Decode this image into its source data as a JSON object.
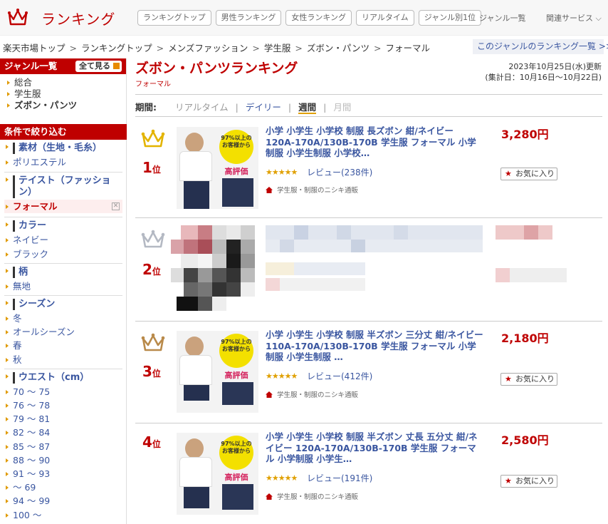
{
  "header": {
    "logo_text": "ランキング",
    "nav_pills": [
      "ランキングトップ",
      "男性ランキング",
      "女性ランキング",
      "リアルタイム",
      "ジャンル別1位"
    ],
    "genre_list_link": "ジャンル一覧",
    "related_services": "関連サービス ⌵"
  },
  "breadcrumb": [
    "楽天市場トップ",
    "ランキングトップ",
    "メンズファッション",
    "学生服",
    "ズボン・パンツ",
    "フォーマル"
  ],
  "genre_ranking_link": "このジャンルのランキング一覧 >>",
  "sidebar": {
    "genre_header": "ジャンル一覧",
    "all_button": "全て見る",
    "genres": [
      "総合",
      "学生服",
      "ズボン・パンツ"
    ],
    "filter_header": "条件で絞り込む",
    "groups": [
      {
        "title": "素材（生地・毛糸）",
        "items": [
          "ポリエステル"
        ]
      },
      {
        "title": "テイスト（ファッション）",
        "items": [
          "フォーマル"
        ]
      },
      {
        "title": "カラー",
        "items": [
          "ネイビー",
          "ブラック"
        ]
      },
      {
        "title": "柄",
        "items": [
          "無地"
        ]
      },
      {
        "title": "シーズン",
        "items": [
          "冬",
          "オールシーズン",
          "春",
          "秋"
        ]
      },
      {
        "title": "ウエスト（cm）",
        "items": [
          "70 ～ 75",
          "76 ～ 78",
          "79 ～ 81",
          "82 ～ 84",
          "85 ～ 87",
          "88 ～ 90",
          "91 ～ 93",
          "～ 69",
          "94 ～ 99",
          "100 ～"
        ]
      }
    ]
  },
  "main": {
    "title": "ズボン・パンツランキング",
    "subtitle": "フォーマル",
    "update_line1": "2023年10月25日(水)更新",
    "update_line2": "(集計日：10月16日～10月22日)",
    "period_label": "期間:",
    "periods": [
      "リアルタイム",
      "デイリー",
      "週間",
      "月間"
    ]
  },
  "items": [
    {
      "rank": "1",
      "rank_suffix": "位",
      "name": "小学 小学生 小学校 制服 長ズボン 紺/ネイビー 120A-170A/130B-170B 学生服 フォーマル 小学制服 小学生制服 小学校…",
      "price": "3,280円",
      "stars": "★★★★★",
      "reviews": "レビュー(238件)",
      "shop": "学生服・制服のニシキ通販",
      "fav": "お気に入り",
      "crown_color": "#e3b400"
    },
    {
      "rank": "2",
      "rank_suffix": "位",
      "crown_color": "#b4b9c3"
    },
    {
      "rank": "3",
      "rank_suffix": "位",
      "name": "小学 小学生 小学校 制服 半ズボン 三分丈 紺/ネイビー 110A-170A/130B-170B 学生服 フォーマル 小学制服 小学生制服 …",
      "price": "2,180円",
      "stars": "★★★★★",
      "reviews": "レビュー(412件)",
      "shop": "学生服・制服のニシキ通販",
      "fav": "お気に入り",
      "crown_color": "#b98a4a"
    },
    {
      "rank": "4",
      "rank_suffix": "位",
      "name": "小学 小学生 小学校 制服 半ズボン 丈長 五分丈 紺/ネイビー 120A-170A/130B-170B 学生服 フォーマル 小学制服 小学生…",
      "price": "2,580円",
      "stars": "★★★★★",
      "reviews": "レビュー(191件)",
      "shop": "学生服・制服のニシキ通販",
      "fav": "お気に入り"
    }
  ],
  "thumb_badge": "97%以上のお客様から",
  "thumb_badge_sub": "高評価"
}
